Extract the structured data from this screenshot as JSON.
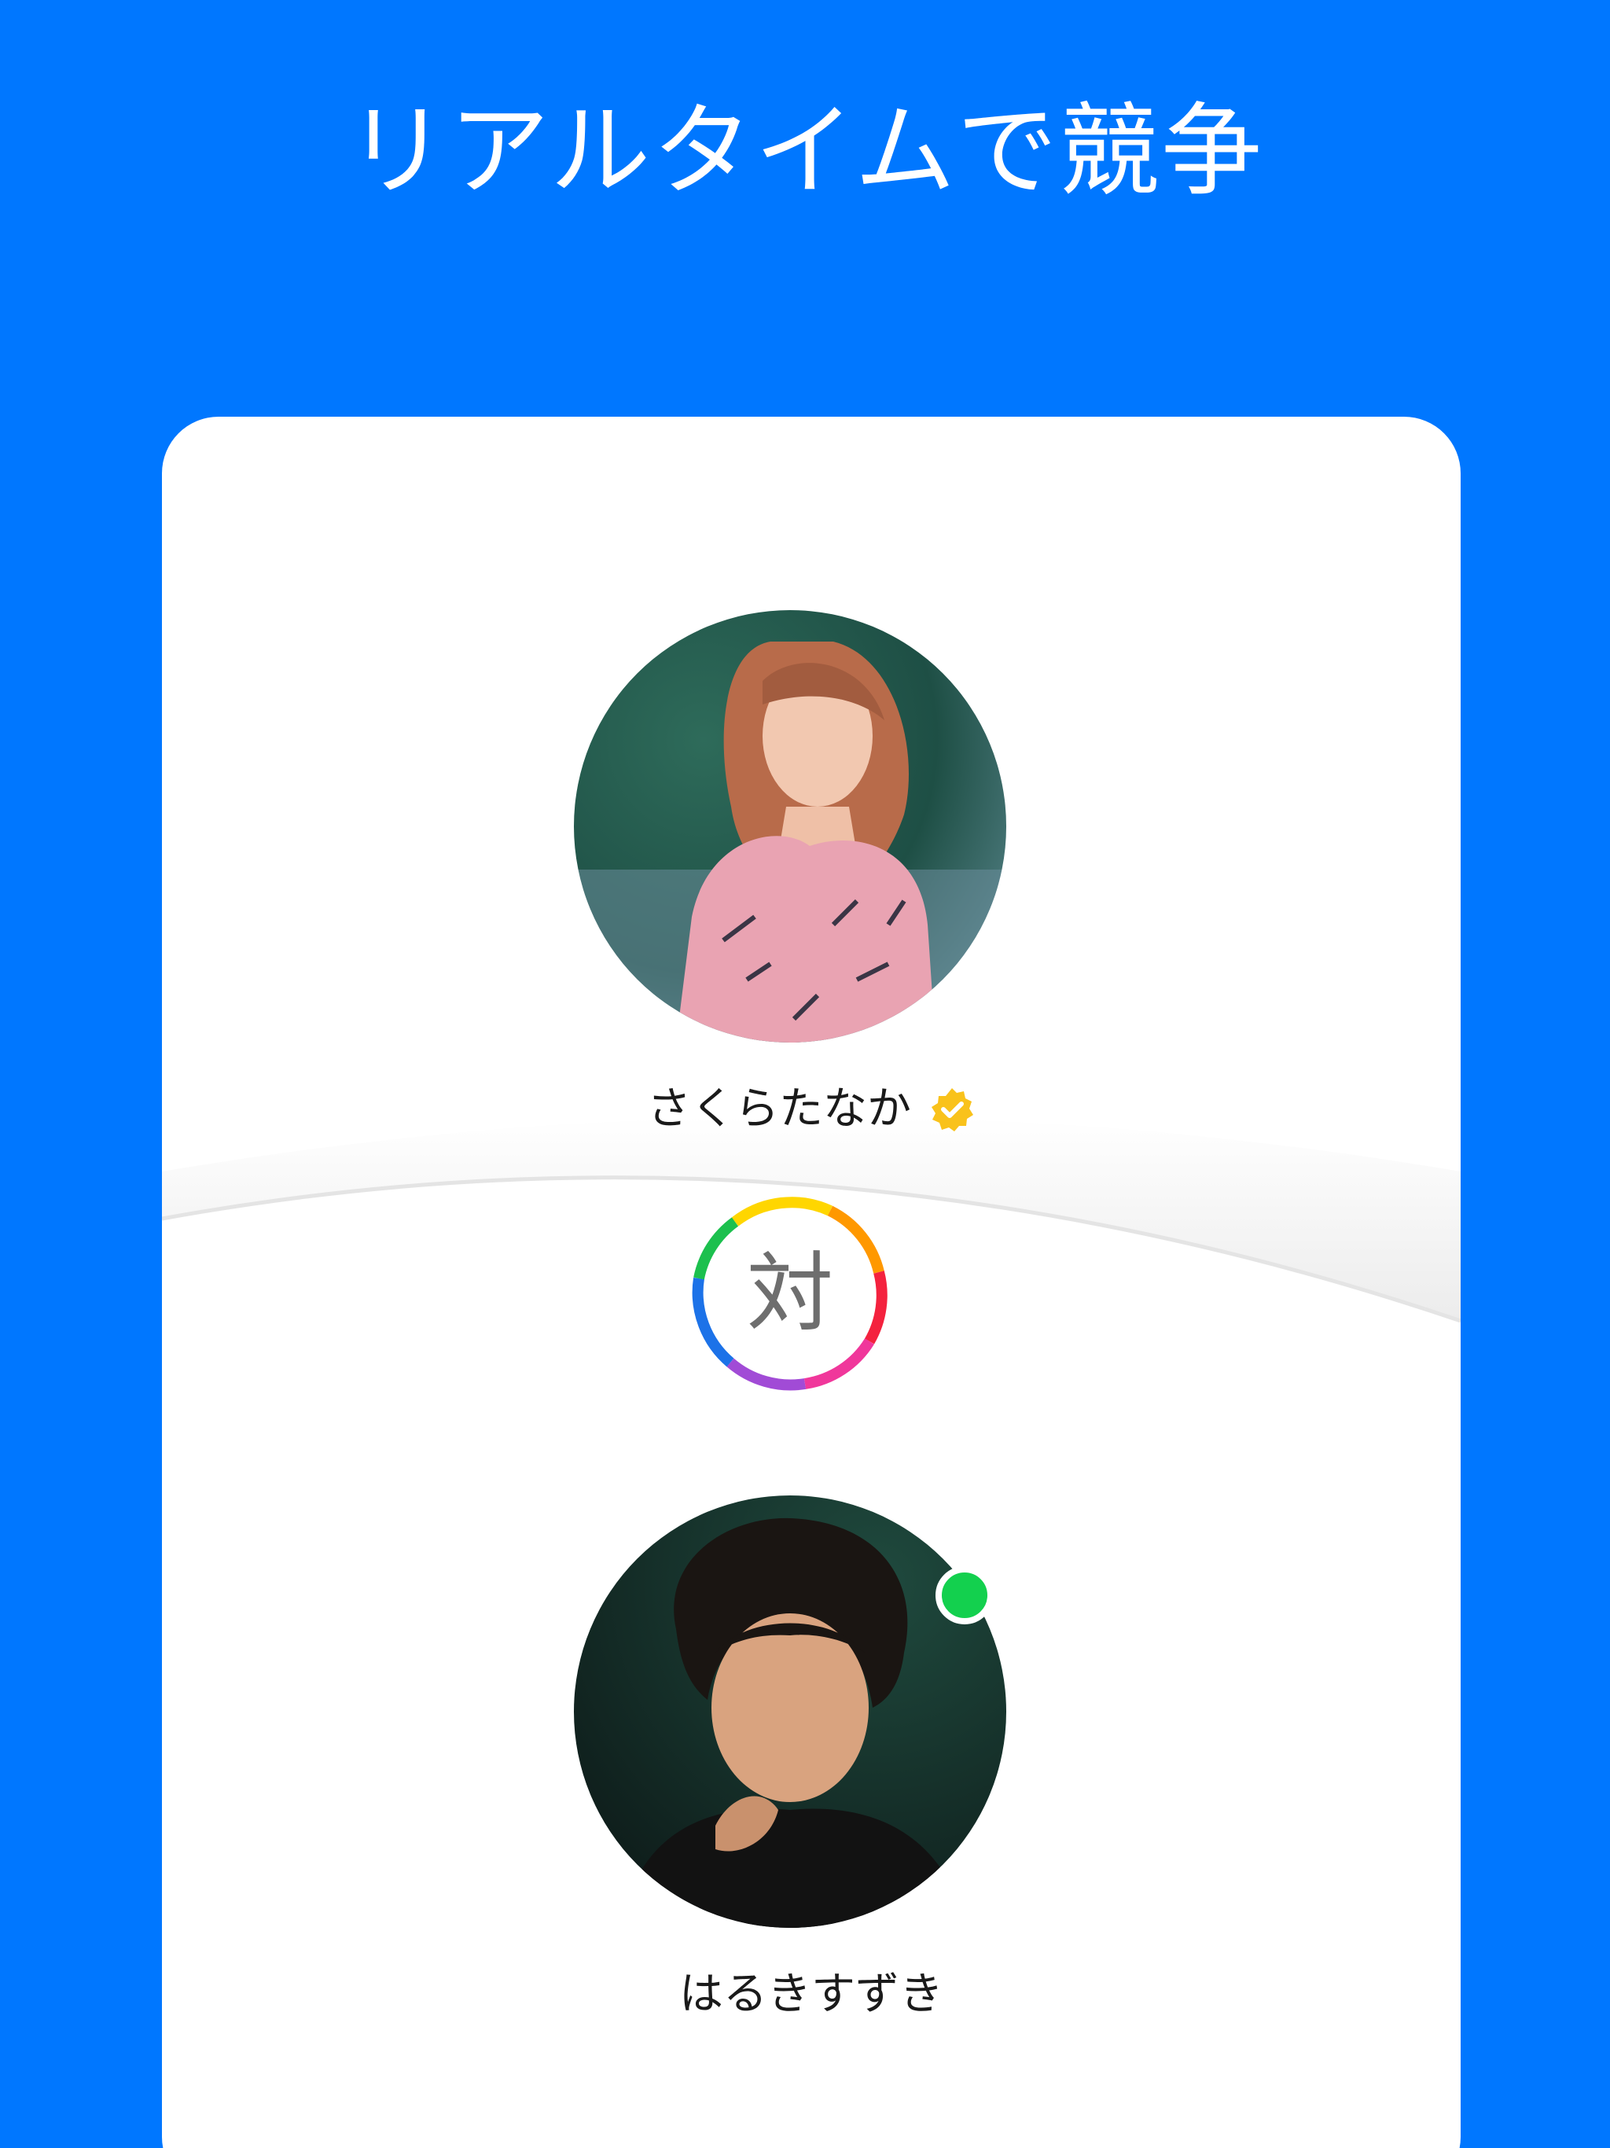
{
  "headline": "リアルタイムで競争",
  "players": {
    "challenger": {
      "name": "さくらたなか",
      "avatar_icon": "avatar-photo-woman",
      "badge_icon": "verified-badge-icon",
      "badge_color": "#F9C21B"
    },
    "opponent": {
      "name": "はるきすずき",
      "avatar_icon": "avatar-photo-man",
      "status_icon": "online-status-dot",
      "status_color": "#13D04E"
    }
  },
  "versus": {
    "label": "対",
    "ring_colors": [
      "#FFD600",
      "#FF9800",
      "#F4223E",
      "#F0379B",
      "#A14BD6",
      "#1C72E8",
      "#1CC04E"
    ]
  },
  "colors": {
    "background": "#0077FF",
    "card": "#FFFFFF"
  }
}
